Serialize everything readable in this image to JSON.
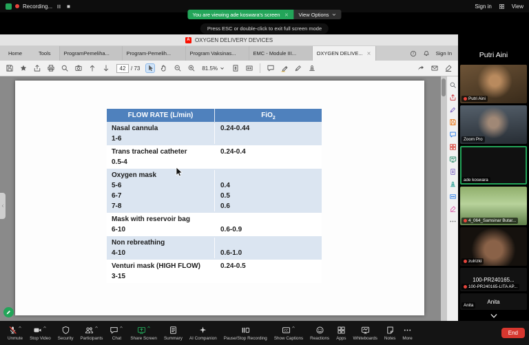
{
  "top_bar": {
    "recording_label": "Recording...",
    "sign_in": "Sign in",
    "view": "View"
  },
  "share_banner": {
    "text": "You are viewing ade koswara's screen",
    "view_options": "View Options"
  },
  "esc_hint": "Press ESC or double-click to exit full screen mode",
  "pdf": {
    "window_title": "OXYGEN DELIVERY DEVICES",
    "menu_tabs": [
      "Home",
      "Tools"
    ],
    "doc_tabs": [
      {
        "label": "ProgramPemeliha...",
        "active": false
      },
      {
        "label": "Program-Pemelih...",
        "active": false
      },
      {
        "label": "Program Vaksinas...",
        "active": false
      },
      {
        "label": "EMC - Module III...",
        "active": false
      },
      {
        "label": "OXYGEN DELIVE...",
        "active": true
      }
    ],
    "sign_in": "Sign In",
    "toolbar": {
      "page_current": "42",
      "page_total": "/ 73",
      "zoom": "81.5%",
      "group1": [
        "save",
        "star",
        "share-up",
        "print",
        "search",
        "snapshot",
        "page-up",
        "page-down"
      ],
      "group2": [
        "pointer",
        "hand",
        "zoom-out",
        "zoom-in"
      ],
      "group3": [
        "fit-page",
        "fit-width"
      ],
      "group4": [
        "comment",
        "highlight",
        "sign-pen",
        "stamp"
      ],
      "right_icons": [
        "share-link",
        "email",
        "fill-sign"
      ]
    },
    "tools_strip": [
      {
        "name": "find",
        "icon": "search",
        "color": "#5f6368"
      },
      {
        "name": "export-pdf",
        "icon": "share-up",
        "color": "#c9252d"
      },
      {
        "name": "edit-pdf",
        "icon": "sign-pen",
        "color": "#7b5fc0"
      },
      {
        "name": "create-pdf",
        "icon": "save",
        "color": "#e8710a"
      },
      {
        "name": "comment",
        "icon": "comment",
        "color": "#1a73e8"
      },
      {
        "name": "combine-files",
        "icon": "apps",
        "color": "#d93025"
      },
      {
        "name": "organize-pages",
        "icon": "board",
        "color": "#12805c"
      },
      {
        "name": "compress-pdf",
        "icon": "fit-page",
        "color": "#7b5fc0"
      },
      {
        "name": "stamp",
        "icon": "stamp",
        "color": "#0d9488"
      },
      {
        "name": "measure",
        "icon": "fit-width",
        "color": "#1a73e8"
      },
      {
        "name": "sign",
        "icon": "fill-sign",
        "color": "#d957a8"
      },
      {
        "name": "more-tools",
        "icon": "dots",
        "color": "#5f6368"
      }
    ],
    "table": {
      "col1_header": "FLOW RATE (L/min)",
      "col2_header": "FiO",
      "col2_header_sub": "2",
      "rows": [
        {
          "shaded": true,
          "flow": [
            "Nasal cannula",
            "1-6"
          ],
          "fio2": [
            "0.24-0.44"
          ]
        },
        {
          "shaded": false,
          "flow": [
            "Trans tracheal catheter",
            "0.5-4"
          ],
          "fio2": [
            "0.24-0.4"
          ]
        },
        {
          "shaded": true,
          "flow": [
            "Oxygen mask",
            "5-6",
            "6-7",
            "7-8"
          ],
          "fio2": [
            "",
            "0.4",
            "0.5",
            "0.6"
          ]
        },
        {
          "shaded": false,
          "flow": [
            "Mask with reservoir bag",
            "6-10"
          ],
          "fio2": [
            "",
            "0.6-0.9"
          ]
        },
        {
          "shaded": true,
          "flow": [
            "Non rebreathing",
            "4-10"
          ],
          "fio2": [
            "",
            "0.6-1.0"
          ]
        },
        {
          "shaded": false,
          "flow": [
            "Venturi mask (HIGH FLOW)",
            "3-15"
          ],
          "fio2": [
            "0.24-0.5"
          ]
        }
      ]
    }
  },
  "participants": {
    "panel_title": "Putri Aini",
    "tiles": [
      {
        "label": "Putri Aini",
        "style": "warm",
        "recording": true
      },
      {
        "label": "Zoom Pro",
        "style": "cool",
        "recording": false
      },
      {
        "label": "ade koswara",
        "style": "dark",
        "active_speaker": true,
        "recording": false
      },
      {
        "label": "4_064_Samsinar Butar...",
        "style": "outdoor",
        "recording": true
      },
      {
        "label": "zulrizki",
        "style": "dim",
        "recording": true
      },
      {
        "label": "100-PR240165-LITA AP...",
        "display_name": "100-PR240165...",
        "style": "none",
        "recording": true
      },
      {
        "label": "Anita",
        "display_name": "Anita",
        "style": "none",
        "small": true,
        "recording": false
      }
    ]
  },
  "control_bar": {
    "items": [
      {
        "label": "Unmute",
        "icon": "mic",
        "caret": true
      },
      {
        "label": "Stop Video",
        "icon": "camera",
        "caret": true
      },
      {
        "label": "Security",
        "icon": "shield"
      },
      {
        "label": "Participants",
        "icon": "people",
        "caret": true
      },
      {
        "label": "Chat",
        "icon": "chat",
        "caret": true
      },
      {
        "label": "Share Screen",
        "icon": "share-screen",
        "caret": true,
        "accent": true
      },
      {
        "label": "Summary",
        "icon": "summary"
      },
      {
        "label": "AI Companion",
        "icon": "sparkle"
      },
      {
        "label": "Pause/Stop Recording",
        "icon": "recording"
      },
      {
        "label": "Show Captions",
        "icon": "cc",
        "caret": true
      },
      {
        "label": "Reactions",
        "icon": "smile"
      },
      {
        "label": "Apps",
        "icon": "apps"
      },
      {
        "label": "Whiteboards",
        "icon": "board"
      },
      {
        "label": "Notes",
        "icon": "note"
      },
      {
        "label": "More",
        "icon": "dots"
      }
    ],
    "end_label": "End"
  }
}
